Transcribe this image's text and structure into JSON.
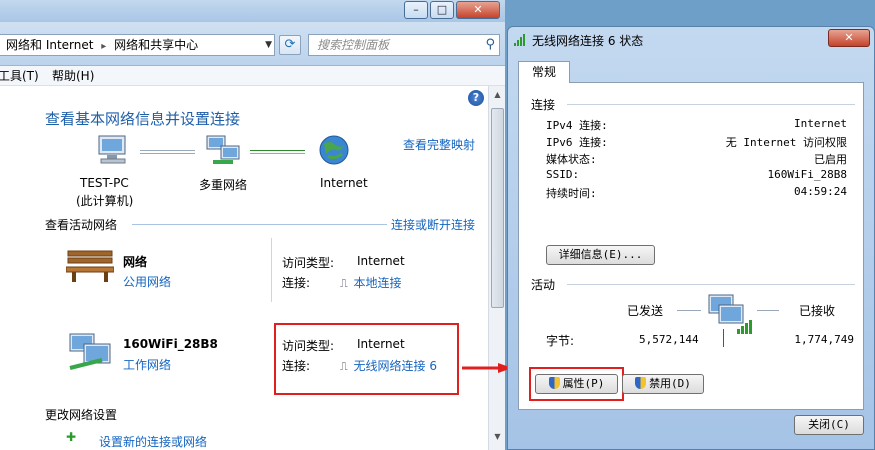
{
  "nsc": {
    "breadcrumb": [
      "网络和 Internet",
      "网络和共享中心"
    ],
    "search_placeholder": "搜索控制面板",
    "menu": [
      "工具(T)",
      "帮助(H)"
    ],
    "heading": "查看基本网络信息并设置连接",
    "view_full_map": "查看完整映射",
    "map": {
      "pc_name": "TEST-PC",
      "pc_sub": "(此计算机)",
      "mid": "多重网络",
      "internet": "Internet"
    },
    "active_title": "查看活动网络",
    "connect_link": "连接或断开连接",
    "networks": [
      {
        "name": "网络",
        "type": "公用网络",
        "access_label": "访问类型:",
        "access_value": "Internet",
        "conn_label": "连接:",
        "conn_value": "本地连接"
      },
      {
        "name": "160WiFi_28B8",
        "type": "工作网络",
        "access_label": "访问类型:",
        "access_value": "Internet",
        "conn_label": "连接:",
        "conn_value": "无线网络连接 6"
      }
    ],
    "change_title": "更改网络设置",
    "setup_link": "设置新的连接或网络",
    "caption": {
      "min": "–",
      "max": "□",
      "close": "✕"
    }
  },
  "dialog": {
    "title": "无线网络连接 6 状态",
    "close": "✕",
    "tab": "常规",
    "group_connection": "连接",
    "rows": [
      {
        "label": "IPv4 连接:",
        "value": "Internet"
      },
      {
        "label": "IPv6 连接:",
        "value": "无 Internet 访问权限"
      },
      {
        "label": "媒体状态:",
        "value": "已启用"
      },
      {
        "label": "SSID:",
        "value": "160WiFi_28B8"
      },
      {
        "label": "持续时间:",
        "value": "04:59:24"
      }
    ],
    "details_button": "详细信息(E)...",
    "group_activity": "活动",
    "sent": "已发送",
    "received": "已接收",
    "bytes_label": "字节:",
    "bytes_sent": "5,572,144",
    "bytes_received": "1,774,749",
    "properties_button": "属性(P)",
    "disable_button": "禁用(D)",
    "close_button": "关闭(C)"
  },
  "colors": {
    "highlight_box": "#e0201e",
    "link": "#1565c0"
  }
}
